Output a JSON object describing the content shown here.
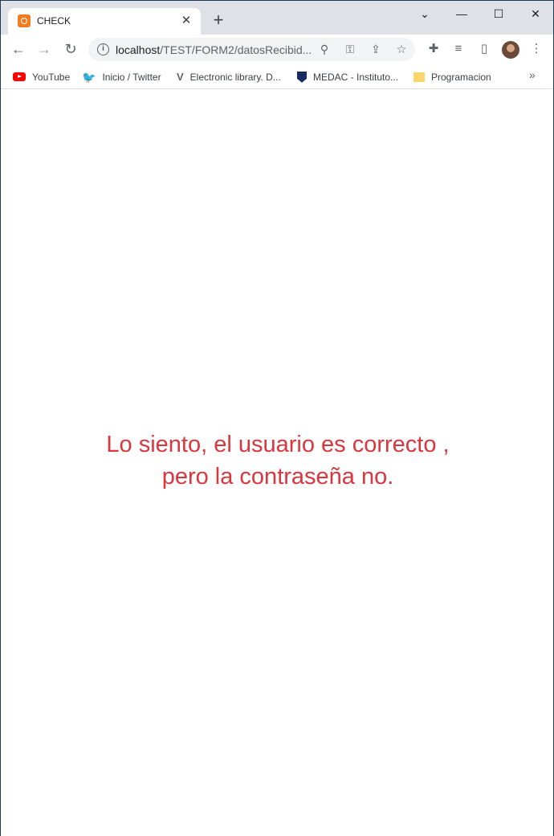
{
  "tab": {
    "title": "CHECK"
  },
  "window_controls": {
    "dropdown": "⌄",
    "minimize": "—",
    "maximize": "☐",
    "close": "✕"
  },
  "omnibox": {
    "host": "localhost",
    "path": "/TEST/FORM2/datosRecibid..."
  },
  "bookmarks": [
    {
      "label": "YouTube"
    },
    {
      "label": "Inicio / Twitter"
    },
    {
      "label": "Electronic library. D..."
    },
    {
      "label": "MEDAC - Instituto..."
    },
    {
      "label": "Programacion"
    }
  ],
  "page": {
    "message_line1": "Lo siento, el usuario es correcto ,",
    "message_line2": "pero la contraseña no.",
    "message_color": "#d9363e"
  }
}
